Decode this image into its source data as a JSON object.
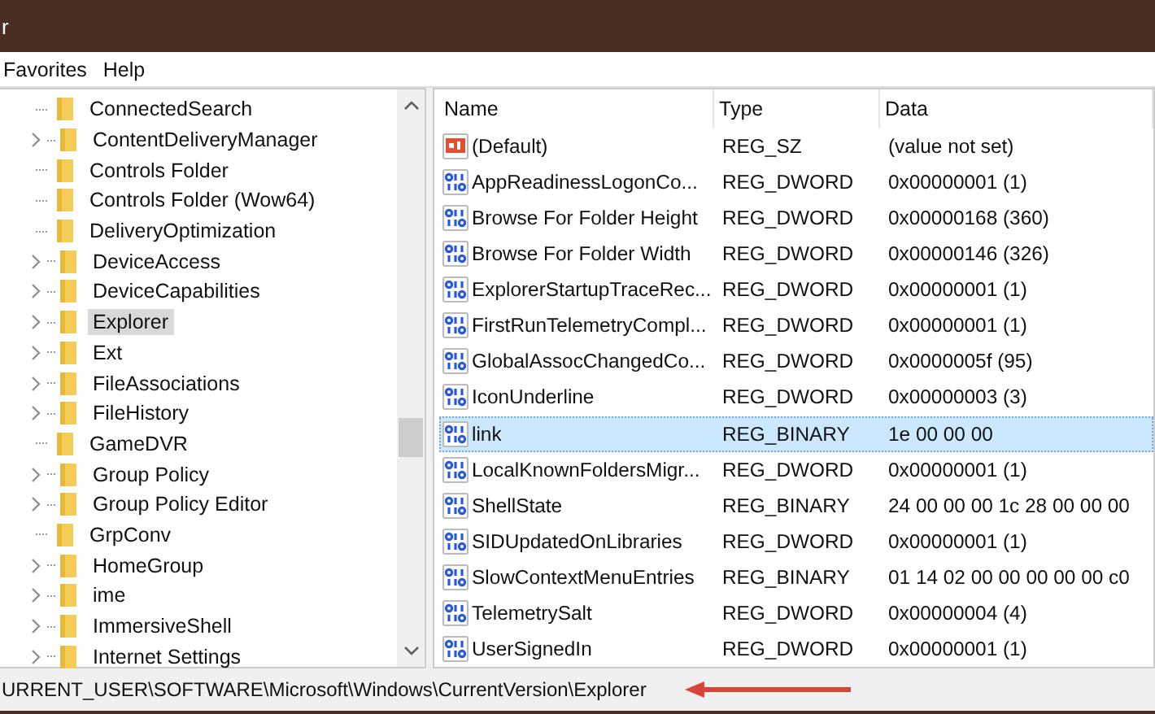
{
  "window": {
    "title": "r"
  },
  "menu": [
    "Favorites",
    "Help"
  ],
  "tree": {
    "items": [
      {
        "label": "ConnectedSearch",
        "expandable": false,
        "selected": false
      },
      {
        "label": "ContentDeliveryManager",
        "expandable": true,
        "selected": false
      },
      {
        "label": "Controls Folder",
        "expandable": false,
        "selected": false
      },
      {
        "label": "Controls Folder (Wow64)",
        "expandable": false,
        "selected": false
      },
      {
        "label": "DeliveryOptimization",
        "expandable": false,
        "selected": false
      },
      {
        "label": "DeviceAccess",
        "expandable": true,
        "selected": false
      },
      {
        "label": "DeviceCapabilities",
        "expandable": true,
        "selected": false
      },
      {
        "label": "Explorer",
        "expandable": true,
        "selected": true
      },
      {
        "label": "Ext",
        "expandable": true,
        "selected": false
      },
      {
        "label": "FileAssociations",
        "expandable": true,
        "selected": false
      },
      {
        "label": "FileHistory",
        "expandable": true,
        "selected": false
      },
      {
        "label": "GameDVR",
        "expandable": false,
        "selected": false
      },
      {
        "label": "Group Policy",
        "expandable": true,
        "selected": false
      },
      {
        "label": "Group Policy Editor",
        "expandable": true,
        "selected": false
      },
      {
        "label": "GrpConv",
        "expandable": false,
        "selected": false
      },
      {
        "label": "HomeGroup",
        "expandable": true,
        "selected": false
      },
      {
        "label": "ime",
        "expandable": true,
        "selected": false
      },
      {
        "label": "ImmersiveShell",
        "expandable": true,
        "selected": false
      },
      {
        "label": "Internet Settings",
        "expandable": true,
        "selected": false
      }
    ]
  },
  "table": {
    "columns": [
      "Name",
      "Type",
      "Data"
    ],
    "rows": [
      {
        "kind": "string",
        "name": "(Default)",
        "type": "REG_SZ",
        "data": "(value not set)",
        "selected": false
      },
      {
        "kind": "binary",
        "name": "AppReadinessLogonCo...",
        "type": "REG_DWORD",
        "data": "0x00000001 (1)",
        "selected": false
      },
      {
        "kind": "binary",
        "name": "Browse For Folder Height",
        "type": "REG_DWORD",
        "data": "0x00000168 (360)",
        "selected": false
      },
      {
        "kind": "binary",
        "name": "Browse For Folder Width",
        "type": "REG_DWORD",
        "data": "0x00000146 (326)",
        "selected": false
      },
      {
        "kind": "binary",
        "name": "ExplorerStartupTraceRec...",
        "type": "REG_DWORD",
        "data": "0x00000001 (1)",
        "selected": false
      },
      {
        "kind": "binary",
        "name": "FirstRunTelemetryCompl...",
        "type": "REG_DWORD",
        "data": "0x00000001 (1)",
        "selected": false
      },
      {
        "kind": "binary",
        "name": "GlobalAssocChangedCo...",
        "type": "REG_DWORD",
        "data": "0x0000005f (95)",
        "selected": false
      },
      {
        "kind": "binary",
        "name": "IconUnderline",
        "type": "REG_DWORD",
        "data": "0x00000003 (3)",
        "selected": false
      },
      {
        "kind": "binary",
        "name": "link",
        "type": "REG_BINARY",
        "data": "1e 00 00 00",
        "selected": true
      },
      {
        "kind": "binary",
        "name": "LocalKnownFoldersMigr...",
        "type": "REG_DWORD",
        "data": "0x00000001 (1)",
        "selected": false
      },
      {
        "kind": "binary",
        "name": "ShellState",
        "type": "REG_BINARY",
        "data": "24 00 00 00 1c 28 00 00 00",
        "selected": false
      },
      {
        "kind": "binary",
        "name": "SIDUpdatedOnLibraries",
        "type": "REG_DWORD",
        "data": "0x00000001 (1)",
        "selected": false
      },
      {
        "kind": "binary",
        "name": "SlowContextMenuEntries",
        "type": "REG_BINARY",
        "data": "01 14 02 00 00 00 00 00 c0",
        "selected": false
      },
      {
        "kind": "binary",
        "name": "TelemetrySalt",
        "type": "REG_DWORD",
        "data": "0x00000004 (4)",
        "selected": false
      },
      {
        "kind": "binary",
        "name": "UserSignedIn",
        "type": "REG_DWORD",
        "data": "0x00000001 (1)",
        "selected": false
      }
    ]
  },
  "status_bar": "URRENT_USER\\SOFTWARE\\Microsoft\\Windows\\CurrentVersion\\Explorer"
}
